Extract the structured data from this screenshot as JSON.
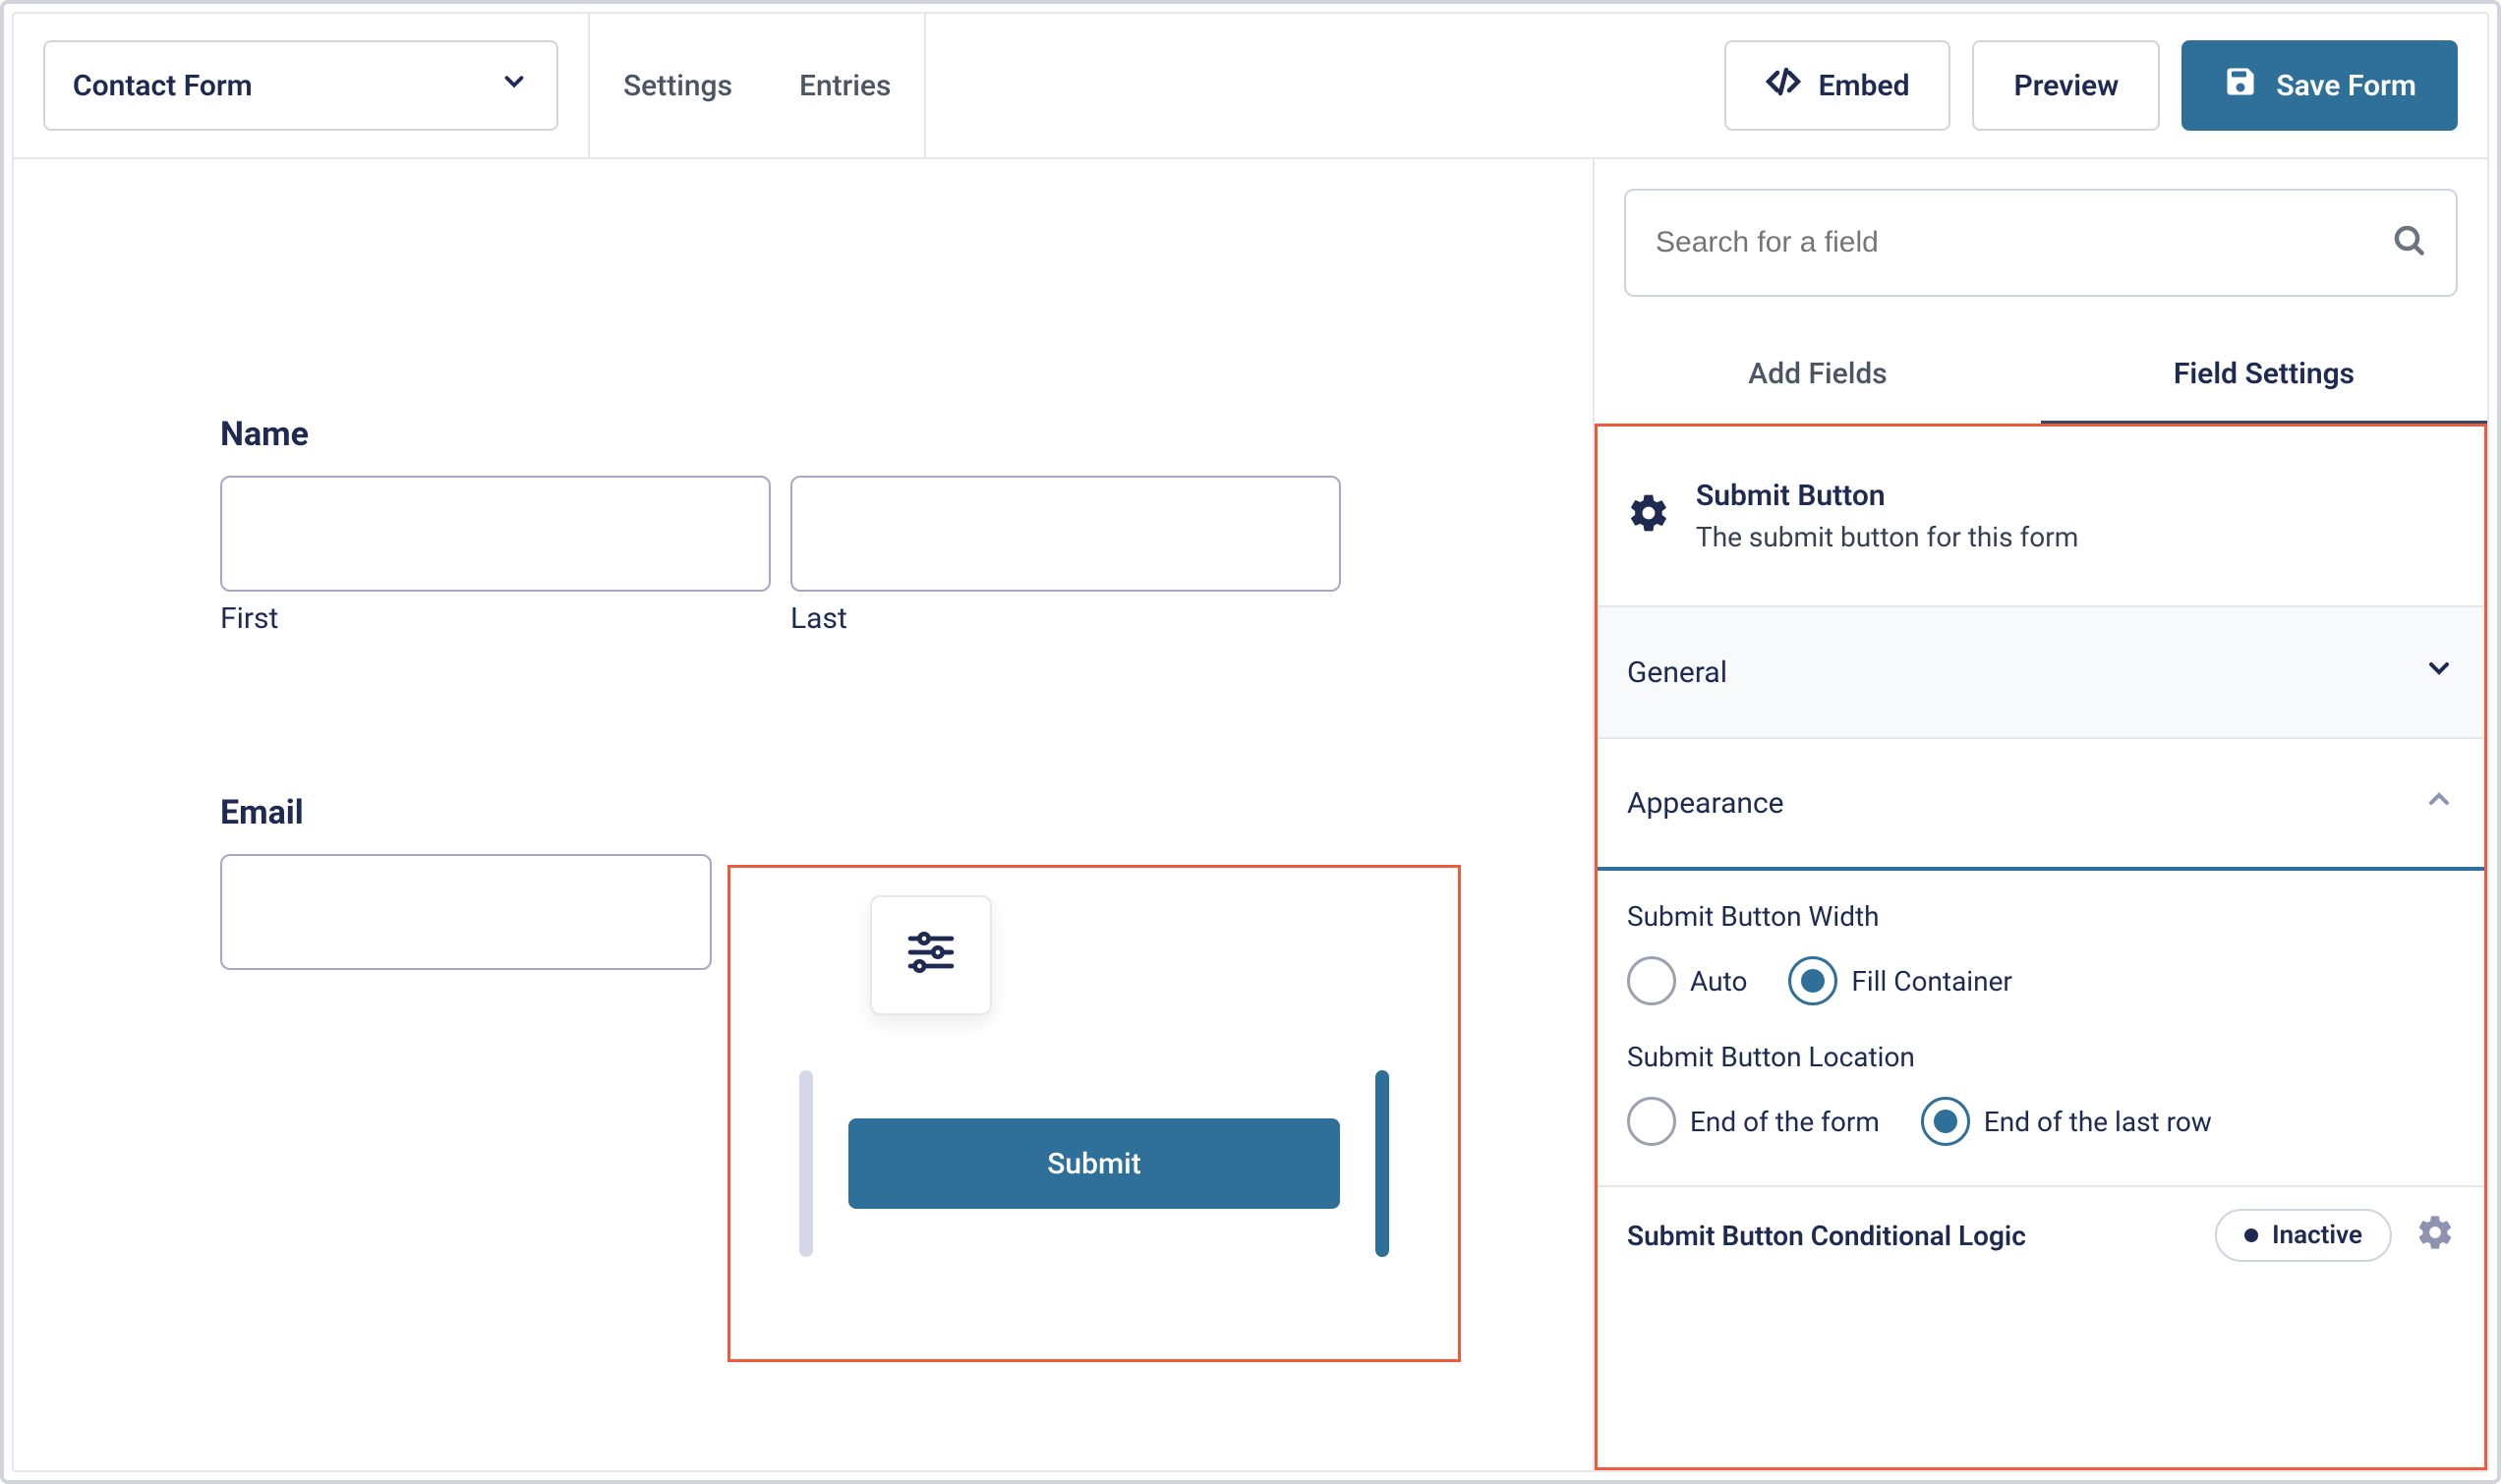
{
  "topbar": {
    "form_name": "Contact Form",
    "tabs": {
      "settings": "Settings",
      "entries": "Entries"
    },
    "embed": "Embed",
    "preview": "Preview",
    "save": "Save Form"
  },
  "canvas": {
    "name_label": "Name",
    "first_label": "First",
    "last_label": "Last",
    "email_label": "Email",
    "submit_label": "Submit"
  },
  "sidebar": {
    "search_placeholder": "Search for a field",
    "tabs": {
      "add": "Add Fields",
      "settings": "Field Settings"
    },
    "field_title": "Submit Button",
    "field_desc": "The submit button for this form",
    "accordions": {
      "general": "General",
      "appearance": "Appearance"
    },
    "settings": {
      "width_label": "Submit Button Width",
      "width_auto": "Auto",
      "width_fill": "Fill Container",
      "location_label": "Submit Button Location",
      "loc_end_form": "End of the form",
      "loc_end_row": "End of the last row",
      "cond_label": "Submit Button Conditional Logic",
      "inactive": "Inactive"
    }
  }
}
